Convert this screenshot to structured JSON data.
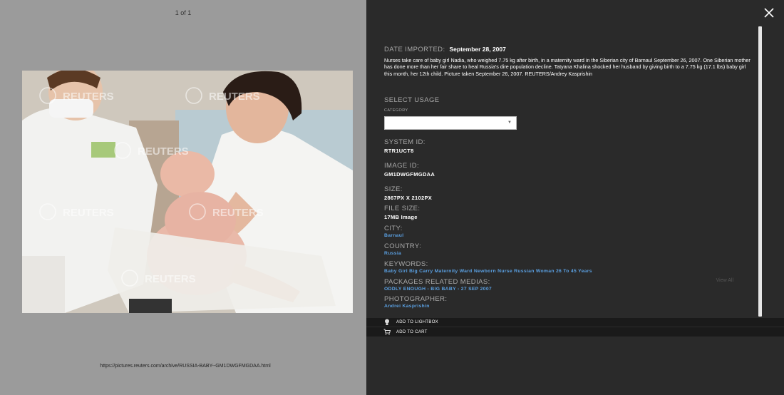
{
  "viewer": {
    "counter": "1 of 1",
    "url": "https://pictures.reuters.com/archive/RUSSIA-BABY--GM1DWGFMGDAA.html",
    "watermark": "REUTERS"
  },
  "details": {
    "date_imported_label": "DATE IMPORTED:",
    "date_imported_value": "September 28, 2007",
    "caption": "Nurses take care of baby girl Nadia, who weighed 7.75 kg after birth, in a maternity ward in the Siberian city of Barnaul September 26, 2007. One Siberian mother has done more than her fair share to heal Russia's dire population decline. Tatyana Khalina shocked her husband by giving birth to a 7.75 kg (17.1 lbs) baby girl this month, her 12th child. Picture taken September 26, 2007. REUTERS/Andrey Kasprishin",
    "select_usage_label": "SELECT USAGE",
    "category_label": "CATEGORY",
    "category_value": "",
    "system_id_label": "SYSTEM ID:",
    "system_id_value": "RTR1UCT8",
    "image_id_label": "IMAGE ID:",
    "image_id_value": "GM1DWGFMGDAA",
    "size_label": "SIZE:",
    "size_value": "2867PX X 2102PX",
    "file_size_label": "FILE SIZE:",
    "file_size_value": "17MB Image",
    "city_label": "CITY:",
    "city_value": "Barnaul",
    "country_label": "COUNTRY:",
    "country_value": "Russia",
    "keywords_label": "KEYWORDS:",
    "keywords_value": "Baby Girl Big Carry Maternity Ward Newborn Nurse Russian Woman 26 To 45 Years",
    "packages_label": "PACKAGES RELATED MEDIAS:",
    "packages_value": "ODDLY ENOUGH - BIG BABY - 27 SEP 2007",
    "view_all": "View All",
    "photographer_label": "PHOTOGRAPHER:",
    "photographer_value": "Andrei Kasprishin"
  },
  "actions": {
    "lightbox": "ADD TO LIGHTBOX",
    "cart": "ADD TO CART"
  },
  "colors": {
    "panel": "#2a2a2a",
    "link": "#5a9fe0",
    "backdrop": "#9b9b9b"
  }
}
